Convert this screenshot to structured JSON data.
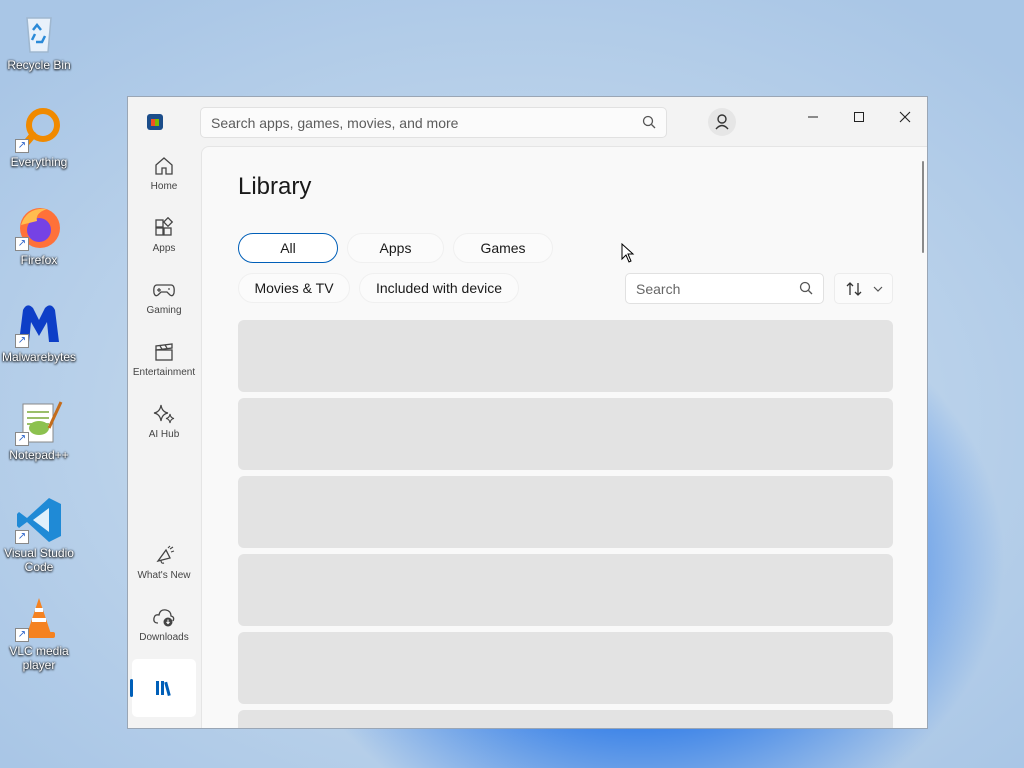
{
  "desktop": {
    "icons": [
      {
        "label": "Recycle Bin"
      },
      {
        "label": "Everything"
      },
      {
        "label": "Firefox"
      },
      {
        "label": "Malwarebytes"
      },
      {
        "label": "Notepad++"
      },
      {
        "label": "Visual Studio Code"
      },
      {
        "label": "VLC media player"
      }
    ]
  },
  "window": {
    "search_placeholder": "Search apps, games, movies, and more",
    "nav": [
      {
        "label": "Home",
        "icon": "home-icon"
      },
      {
        "label": "Apps",
        "icon": "apps-icon"
      },
      {
        "label": "Gaming",
        "icon": "gamepad-icon"
      },
      {
        "label": "Entertainment",
        "icon": "clapperboard-icon"
      },
      {
        "label": "AI Hub",
        "icon": "sparkle-icon"
      },
      {
        "label": "What's New",
        "icon": "megaphone-icon"
      },
      {
        "label": "Downloads",
        "icon": "cloud-download-icon"
      },
      {
        "label": "",
        "icon": "library-icon"
      }
    ],
    "library": {
      "title": "Library",
      "filters": [
        "All",
        "Apps",
        "Games",
        "Movies & TV",
        "Included with device"
      ],
      "selected_filter": "All",
      "search_placeholder": "Search"
    }
  },
  "colors": {
    "accent": "#005fb8",
    "placeholder": "#e3e3e3"
  }
}
